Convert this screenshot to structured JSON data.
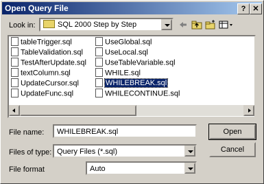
{
  "window": {
    "title": "Open Query File",
    "help_label": "?",
    "close_label": "✕"
  },
  "look_in": {
    "label": "Look in:",
    "value": "SQL 2000 Step by Step"
  },
  "files": {
    "column1": [
      "tableTrigger.sql",
      "TableValidation.sql",
      "TestAfterUpdate.sql",
      "textColumn.sql",
      "UpdateCursor.sql",
      "UpdateFunc.sql"
    ],
    "column2": [
      "UseGlobal.sql",
      "UseLocal.sql",
      "UseTableVariable.sql",
      "WHILE.sql",
      "WHILEBREAK.sql",
      "WHILECONTINUE.sql"
    ],
    "selected": "WHILEBREAK.sql"
  },
  "file_name": {
    "label": "File name:",
    "value": "WHILEBREAK.sql"
  },
  "files_of_type": {
    "label": "Files of type:",
    "value": "Query Files (*.sql)"
  },
  "file_format": {
    "label": "File format",
    "value": "Auto"
  },
  "buttons": {
    "open": "Open",
    "cancel": "Cancel"
  },
  "toolbar_icons": [
    "back-icon",
    "up-folder-icon",
    "new-folder-icon",
    "views-icon"
  ]
}
